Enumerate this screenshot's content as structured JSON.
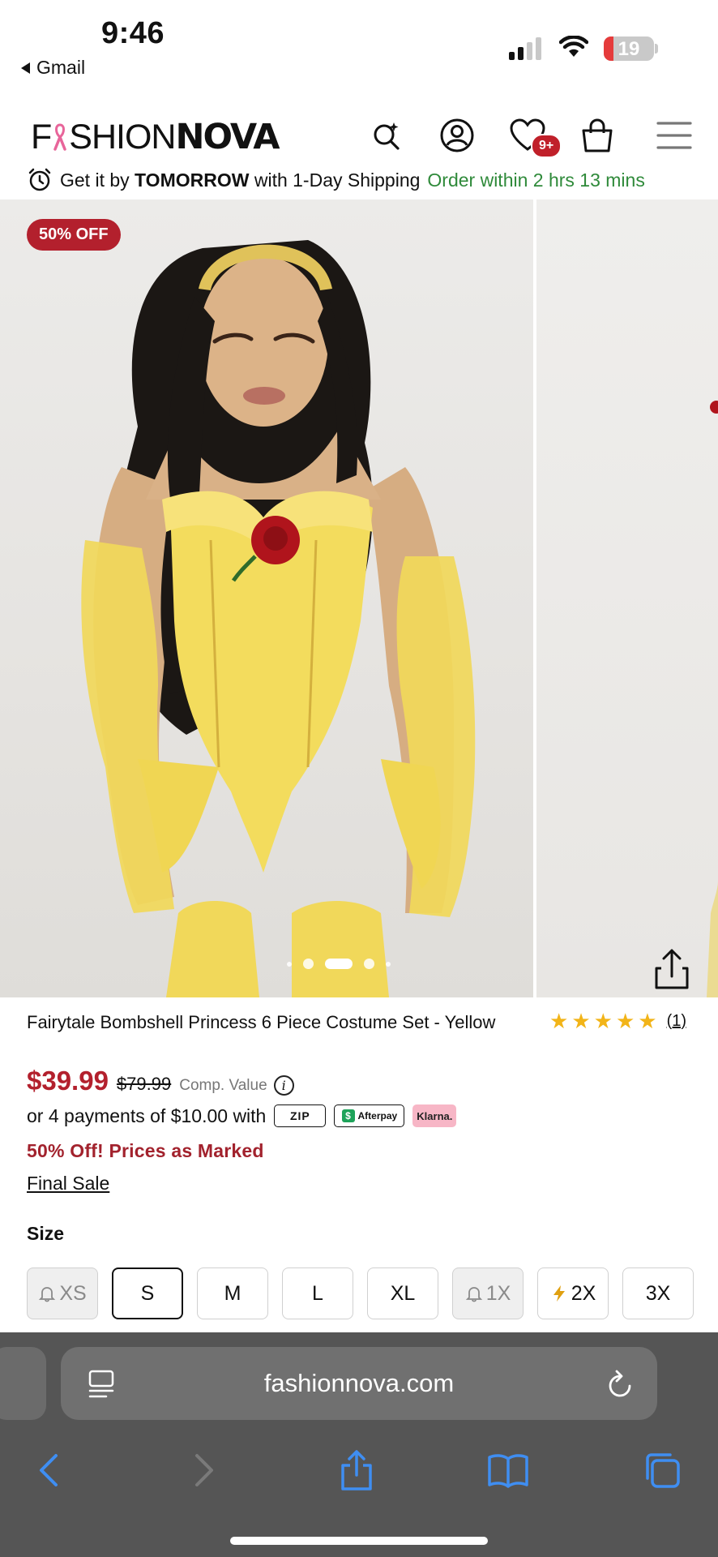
{
  "status_bar": {
    "time": "9:46",
    "back_app": "Gmail",
    "battery": "19",
    "battery_level": 0.19,
    "signal_bars": 2
  },
  "header": {
    "logo_light": "F",
    "logo_light_2": "SHION",
    "logo_bold": "NOVA",
    "wishlist_badge": "9+",
    "icons": [
      "ai-search-icon",
      "account-icon",
      "heart-icon",
      "bag-icon",
      "menu-icon"
    ]
  },
  "shipping": {
    "prefix": "Get it by",
    "bold": "TOMORROW",
    "suffix": "with 1-Day Shipping",
    "countdown": "Order within 2 hrs 13 mins"
  },
  "gallery": {
    "sale_badge": "50% OFF",
    "image_count": 5,
    "active_index": 2
  },
  "product": {
    "title": "Fairytale Bombshell Princess 6 Piece Costume Set - Yellow",
    "rating": 5,
    "review_count": "(1)",
    "price": "$39.99",
    "original_price": "$79.99",
    "comp_label": "Comp. Value",
    "installments": "or 4 payments of $10.00 with",
    "pay_logos": {
      "zip": "ZIP",
      "afterpay": "Afterpay",
      "klarna": "Klarna."
    },
    "promo": "50% Off! Prices as Marked",
    "final_sale": "Final Sale",
    "size_label": "Size",
    "sizes": [
      {
        "label": "XS",
        "state": "notify"
      },
      {
        "label": "S",
        "state": "selected"
      },
      {
        "label": "M",
        "state": "available"
      },
      {
        "label": "L",
        "state": "available"
      },
      {
        "label": "XL",
        "state": "available"
      },
      {
        "label": "1X",
        "state": "notify"
      },
      {
        "label": "2X",
        "state": "low-stock"
      },
      {
        "label": "3X",
        "state": "available"
      }
    ]
  },
  "browser": {
    "url": "fashionnova.com"
  },
  "colors": {
    "sale_red": "#b3202d",
    "green": "#2f8a3a",
    "star": "#f2b418",
    "chrome": "#555555",
    "ios_blue": "#3f8ef2"
  }
}
